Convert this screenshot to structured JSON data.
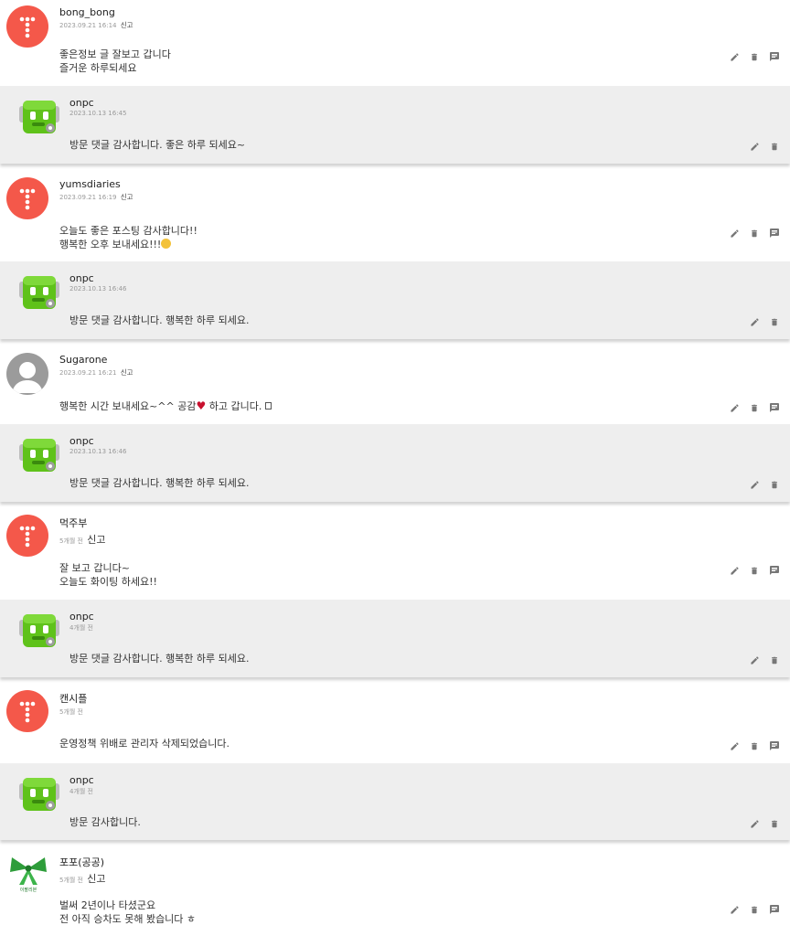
{
  "comments": [
    {
      "name": "bong_bong",
      "date": "2023.09.21 16:14",
      "report": "신고",
      "avatar": "red-dots",
      "lines": [
        "좋은정보 글 잘보고 갑니다",
        "즐거운 하루되세요"
      ],
      "reply": {
        "name": "onpc",
        "date": "2023.10.13 16:45",
        "text": "방문 댓글 감사합니다. 좋은 하루 되세요~"
      }
    },
    {
      "name": "yumsdiaries",
      "date": "2023.09.21 16:19",
      "report": "신고",
      "avatar": "red-dots",
      "lines": [
        "오늘도 좋은 포스팅 감사합니다!!",
        "행복한 오후 보내세요!!!"
      ],
      "reply": {
        "name": "onpc",
        "date": "2023.10.13 16:46",
        "text": "방문 댓글 감사합니다. 행복한 하루 되세요."
      }
    },
    {
      "name": "Sugarone",
      "date": "2023.09.21 16:21",
      "report": "신고",
      "avatar": "gray-person",
      "lines": [
        "행복한 시간 보내세요~^^ 공감",
        " 하고 갑니다. "
      ],
      "reply": {
        "name": "onpc",
        "date": "2023.10.13 16:46",
        "text": "방문 댓글 감사합니다. 행복한 하루 되세요."
      }
    },
    {
      "name": "먹주부",
      "date": "5개월 전",
      "report": "신고",
      "avatar": "red-dots",
      "lines": [
        "잘 보고 갑니다~",
        "오늘도 화이팅 하세요!!"
      ],
      "reply": {
        "name": "onpc",
        "date": "4개월 전",
        "text": "방문 댓글 감사합니다. 행복한 하루 되세요."
      }
    },
    {
      "name": "캔시플",
      "date": "5개월 전",
      "report": "",
      "avatar": "red-dots",
      "lines": [
        "운영정책 위배로 관리자 삭제되었습니다."
      ],
      "reply": {
        "name": "onpc",
        "date": "4개월 전",
        "text": "방문 감사합니다."
      }
    },
    {
      "name": "포포(공공)",
      "date": "5개월 전",
      "report": "신고",
      "avatar": "green-ribbon",
      "avatar_caption": "이팔리본",
      "lines": [
        "벌써 2년이나 타셨군요",
        "전 아직 승차도 못해 봤습니다 ㅎ"
      ],
      "reply": null
    }
  ],
  "icons": {
    "edit": "pencil-icon",
    "delete": "trash-icon",
    "reply": "comment-icon"
  },
  "colors": {
    "avatar_red": "#f4584a",
    "reply_bg": "#eeeeee",
    "robot_green": "#5fc21a",
    "heart": "#c8102e"
  }
}
